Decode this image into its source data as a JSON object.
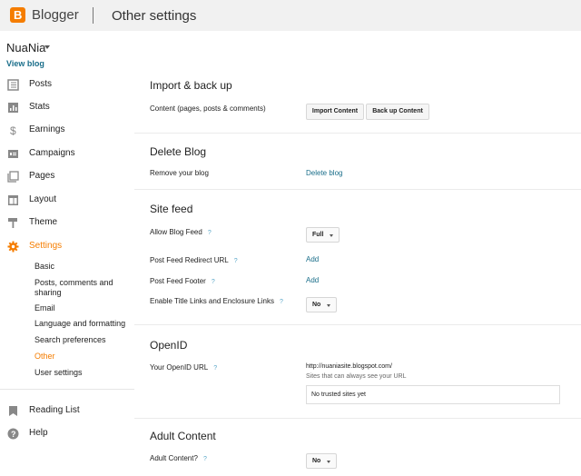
{
  "header": {
    "brand": "Blogger",
    "logo_letter": "B",
    "title": "Other settings"
  },
  "sidebar": {
    "blog_name": "NuaNia",
    "view_blog": "View blog",
    "items": [
      {
        "label": "Posts",
        "icon": "posts-icon"
      },
      {
        "label": "Stats",
        "icon": "stats-icon"
      },
      {
        "label": "Earnings",
        "icon": "dollar-icon"
      },
      {
        "label": "Campaigns",
        "icon": "campaigns-icon"
      },
      {
        "label": "Pages",
        "icon": "pages-icon"
      },
      {
        "label": "Layout",
        "icon": "layout-icon"
      },
      {
        "label": "Theme",
        "icon": "theme-icon"
      },
      {
        "label": "Settings",
        "icon": "gear-icon"
      }
    ],
    "settings_sub": [
      {
        "label": "Basic"
      },
      {
        "label": "Posts, comments and sharing"
      },
      {
        "label": "Email"
      },
      {
        "label": "Language and formatting"
      },
      {
        "label": "Search preferences"
      },
      {
        "label": "Other"
      },
      {
        "label": "User settings"
      }
    ],
    "reading_list": "Reading List",
    "help": "Help"
  },
  "main": {
    "import": {
      "title": "Import & back up",
      "row_label": "Content (pages, posts & comments)",
      "import_button": "Import Content",
      "backup_button": "Back up Content"
    },
    "delete": {
      "title": "Delete Blog",
      "row_label": "Remove your blog",
      "link": "Delete blog"
    },
    "feed": {
      "title": "Site feed",
      "allow_label": "Allow Blog Feed",
      "allow_value": "Full",
      "redirect_label": "Post Feed Redirect URL",
      "redirect_link": "Add",
      "footer_label": "Post Feed Footer",
      "footer_link": "Add",
      "title_links_label": "Enable Title Links and Enclosure Links",
      "title_links_value": "No"
    },
    "openid": {
      "title": "OpenID",
      "url_label": "Your OpenID URL",
      "url_value": "http://nuaniasite.blogspot.com/",
      "sites_label": "Sites that can always see your URL",
      "sites_value": "No trusted sites yet"
    },
    "adult": {
      "title": "Adult Content",
      "label": "Adult Content?",
      "value": "No"
    },
    "help_mark": "?"
  },
  "colors": {
    "accent": "#f57d00",
    "link": "#1a6e8a",
    "help": "#5aa7c9"
  }
}
